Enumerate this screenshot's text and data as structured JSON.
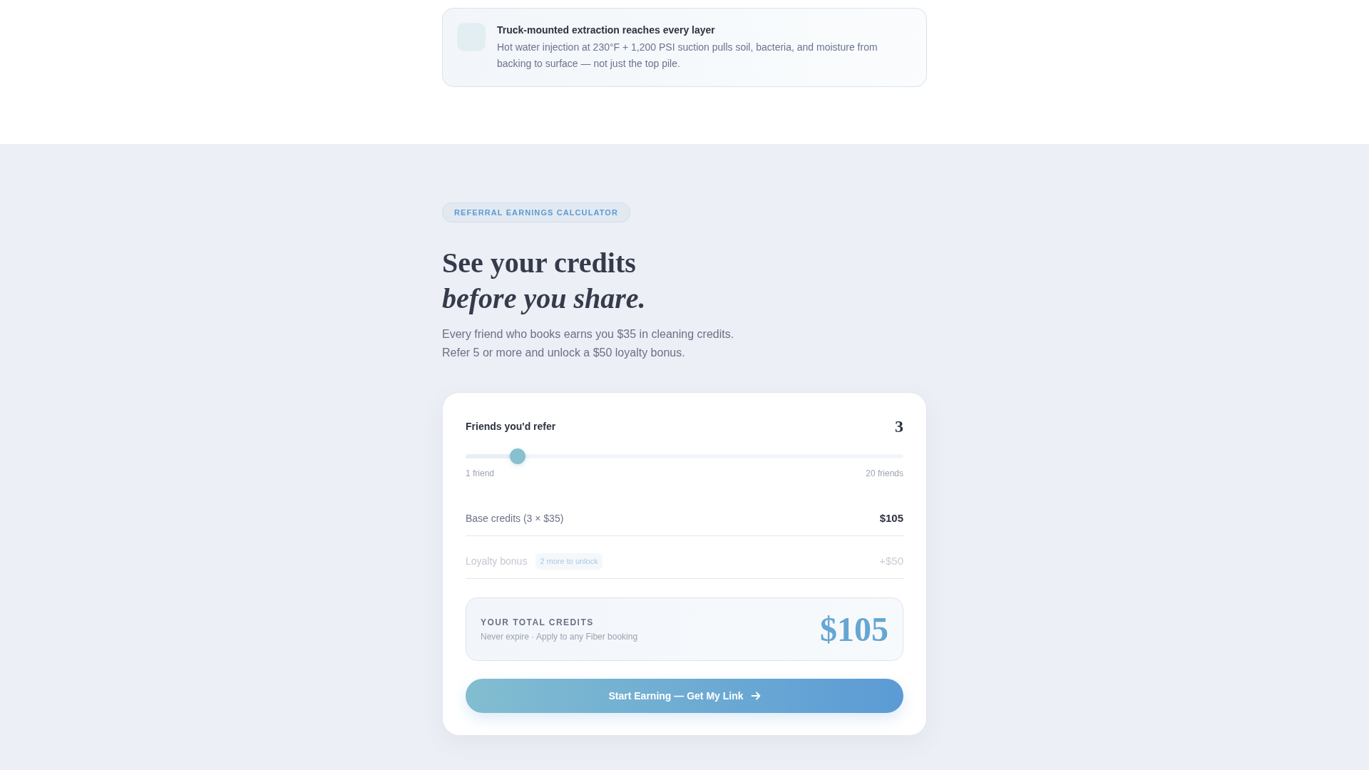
{
  "feature_card": {
    "title": "Truck-mounted extraction reaches every layer",
    "description": "Hot water injection at 230°F + 1,200 PSI suction pulls soil, bacteria, and moisture from backing to surface — not just the top pile."
  },
  "calculator": {
    "badge": "REFERRAL EARNINGS CALCULATOR",
    "heading": {
      "line_1": "See your credits",
      "line_2": "before you share."
    },
    "intro": "Every friend who books earns you $35 in cleaning credits. Refer 5 or more and unlock a $50 loyalty bonus.",
    "card": {
      "slider": {
        "label": "Friends you'd refer",
        "value": "3",
        "level": 0.105,
        "min_label": "1 friend",
        "max_label": "20 friends"
      },
      "rows": [
        {
          "label": "Base credits (3 × $35)",
          "amount": "$105",
          "disabled": false
        },
        {
          "label": "Loyalty bonus",
          "tag": "2 more to unlock",
          "amount": "+$50",
          "disabled": true
        }
      ],
      "total": {
        "label": "YOUR TOTAL CREDITS",
        "note": "Never expire · Apply to any Fiber booking",
        "amount": "$105"
      },
      "button": {
        "label": "Start Earning — Get My Link"
      }
    }
  }
}
